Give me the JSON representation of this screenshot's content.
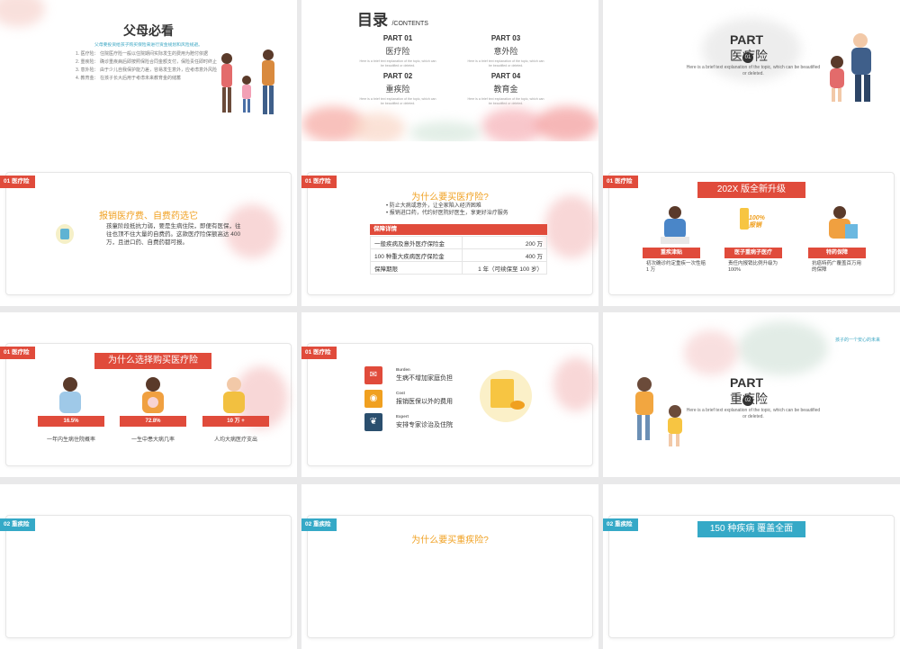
{
  "slide1": {
    "title": "父母必看",
    "subtitle": "父母要投资给孩子购买保险来进行资金规划和风险规避。",
    "items": [
      "1. 医疗险： 住院医疗险一般以住院期间实际发生的费用为赔付依据",
      "2. 重疾险： 确诊重疾病后即按照保险合同金额支付，保险责任即时终止",
      "3. 意外险： 由于少儿自我保护能力差，容易发生意外，应考虑意外风险",
      "4. 教育金： 在孩子长大后用于考虑未来教育金的储蓄"
    ]
  },
  "slide2": {
    "title": "目录",
    "subtitle": "/CONTENTS",
    "desc": "Here is a brief text explanation of the topic, which can be beautified or deleted.",
    "parts": [
      {
        "num": "PART  01",
        "name": "医疗险"
      },
      {
        "num": "PART  03",
        "name": "意外险"
      },
      {
        "num": "PART  02",
        "name": "重疾险"
      },
      {
        "num": "PART  04",
        "name": "教育金"
      }
    ]
  },
  "slide3": {
    "part": "PART",
    "num": "01",
    "name": "医疗险",
    "desc": "Here is a brief text explanation of the topic, which can be beautified or deleted."
  },
  "slide4": {
    "tag": "01  医疗险",
    "heading": "报销医疗费、自费药选它",
    "body": "孩童阶段抵抗力弱，要是生病住院，即便有医保，往往也顶不住大量的自费药。这款医疗险保额高达 400 万，且进口药、自费药都可报。"
  },
  "slide5": {
    "tag": "01  医疗险",
    "heading": "为什么要买医疗险?",
    "bullets": [
      "防止大病或意外，让全家陷入经济困难",
      "报销进口药，代约好医院好医生，享更好治疗服务"
    ],
    "table_title": "保障详情",
    "rows": [
      {
        "label": "一般疾病及意外医疗保险金",
        "value": "200 万"
      },
      {
        "label": "100 种重大疾病医疗保险金",
        "value": "400 万"
      },
      {
        "label": "保障期限",
        "value": "1 年（可续保至 100 岁）"
      }
    ]
  },
  "slide6": {
    "tag": "01  医疗险",
    "banner": "202X 版全新升级",
    "badge": "100%\n报销",
    "cols": [
      {
        "label": "重疾津贴",
        "desc": "初次确诊约定重疾一次性赔 1 万"
      },
      {
        "label": "医子重病子医疗",
        "desc": "责任内报销比例升级为 100%"
      },
      {
        "label": "特药保障",
        "desc": "抗癌特药广覆盖百万用的保障"
      }
    ]
  },
  "slide7": {
    "tag": "01  医疗险",
    "banner": "为什么选择购买医疗险",
    "stats": [
      {
        "value": "16.5%",
        "label": "一年内生病住院概率"
      },
      {
        "value": "72.8%",
        "label": "一生中患大病几率"
      },
      {
        "value": "10 万 +",
        "label": "人均大病医疗支出"
      }
    ]
  },
  "slide8": {
    "tag": "01  医疗险",
    "items": [
      {
        "title": "Burden",
        "text": "生病不增加家庭负担",
        "color": "#e04b3b"
      },
      {
        "title": "Cost",
        "text": "报销医保以外的费用",
        "color": "#f0a020"
      },
      {
        "title": "Expert",
        "text": "安排专家诊治及住院",
        "color": "#2b4f6e"
      }
    ]
  },
  "slide9": {
    "corner": "孩子的一个安心的未来",
    "part": "PART",
    "num": "02",
    "name": "重疾险",
    "desc": "Here is a brief text explanation of the topic, which can be beautified or deleted."
  },
  "slide10": {
    "tag": "02  重疾险"
  },
  "slide11": {
    "tag": "02  重疾险",
    "heading": "为什么要买重疾险?"
  },
  "slide12": {
    "tag": "02  重疾险",
    "banner": "150 种疾病 覆盖全面"
  }
}
